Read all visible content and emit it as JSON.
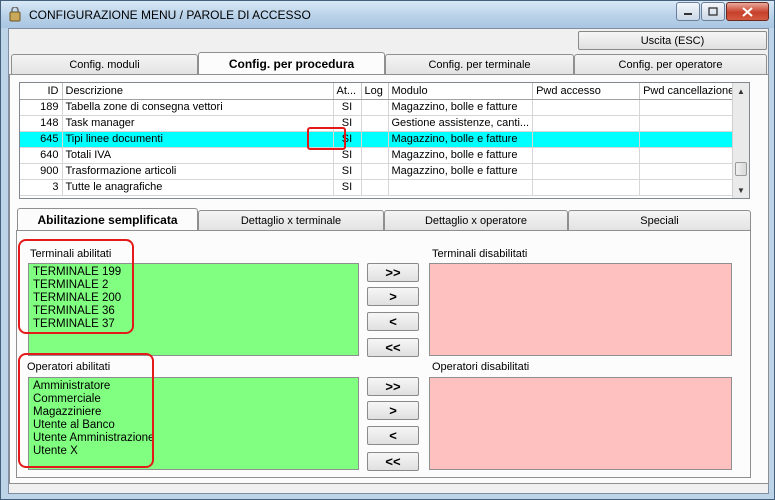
{
  "window": {
    "title": "CONFIGURAZIONE MENU / PAROLE DI ACCESSO"
  },
  "toolbar": {
    "exit_label": "Uscita (ESC)"
  },
  "main_tabs": [
    {
      "label": "Config. moduli"
    },
    {
      "label": "Config. per procedura"
    },
    {
      "label": "Config. per terminale"
    },
    {
      "label": "Config. per operatore"
    }
  ],
  "grid": {
    "columns": [
      "ID",
      "Descrizione",
      "At...",
      "Log",
      "Modulo",
      "Pwd accesso",
      "Pwd cancellazione"
    ],
    "rows": [
      {
        "id": "189",
        "desc": "Tabella zone di consegna vettori",
        "at": "SI",
        "log": "",
        "modulo": "Magazzino, bolle e fatture",
        "pwd": "",
        "pwdc": ""
      },
      {
        "id": "148",
        "desc": "Task manager",
        "at": "SI",
        "log": "",
        "modulo": "Gestione assistenze, canti...",
        "pwd": "",
        "pwdc": ""
      },
      {
        "id": "645",
        "desc": "Tipi linee documenti",
        "at": "SI",
        "log": "",
        "modulo": "Magazzino, bolle e fatture",
        "pwd": "",
        "pwdc": "",
        "selected": true
      },
      {
        "id": "640",
        "desc": "Totali IVA",
        "at": "SI",
        "log": "",
        "modulo": "Magazzino, bolle e fatture",
        "pwd": "",
        "pwdc": ""
      },
      {
        "id": "900",
        "desc": "Trasformazione articoli",
        "at": "SI",
        "log": "",
        "modulo": "Magazzino, bolle e fatture",
        "pwd": "",
        "pwdc": ""
      },
      {
        "id": "3",
        "desc": "Tutte le anagrafiche",
        "at": "SI",
        "log": "",
        "modulo": "",
        "pwd": "",
        "pwdc": ""
      }
    ]
  },
  "sub_tabs": [
    {
      "label": "Abilitazione semplificata"
    },
    {
      "label": "Dettaglio x terminale"
    },
    {
      "label": "Dettaglio x operatore"
    },
    {
      "label": "Speciali"
    }
  ],
  "terminals": {
    "enabled_label": "Terminali abilitati",
    "disabled_label": "Terminali disabilitati",
    "enabled": [
      "TERMINALE 199",
      "TERMINALE 2",
      "TERMINALE 200",
      "TERMINALE 36",
      "TERMINALE 37"
    ],
    "disabled": []
  },
  "operators": {
    "enabled_label": "Operatori abilitati",
    "disabled_label": "Operatori disabilitati",
    "enabled": [
      "Amministratore",
      "Commerciale",
      "Magazziniere",
      "Utente al Banco",
      "Utente Amministrazione",
      "Utente X"
    ],
    "disabled": []
  },
  "move_buttons": {
    "all_right": ">>",
    "one_right": ">",
    "one_left": "<",
    "all_left": "<<"
  },
  "colors": {
    "selected_row": "#00ffff",
    "enabled_list": "#80ff80",
    "disabled_list": "#ffc0c0",
    "highlight": "#e41a1a"
  }
}
